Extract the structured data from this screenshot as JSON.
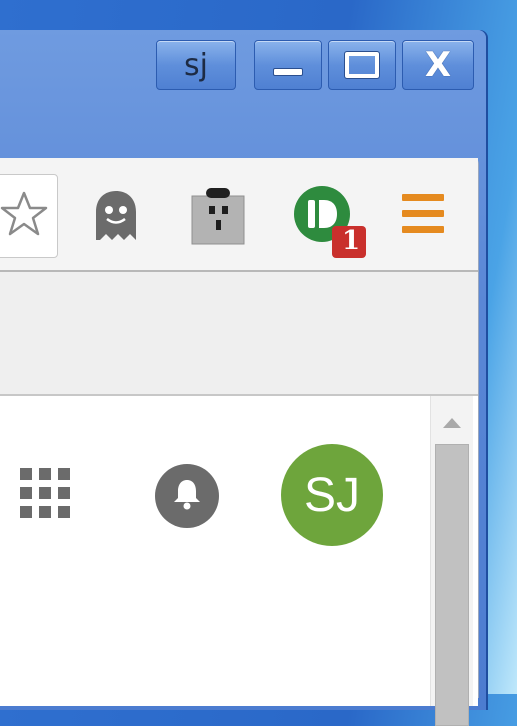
{
  "window": {
    "profile_label": "sj",
    "controls": {
      "minimize_icon": "minimize-icon",
      "maximize_icon": "maximize-icon",
      "close_label": "X"
    }
  },
  "toolbar": {
    "bookmark_icon": "star-icon",
    "extensions": [
      {
        "name": "ghostery",
        "icon": "ghost-icon"
      },
      {
        "name": "face",
        "icon": "square-face-icon"
      },
      {
        "name": "pushbullet",
        "icon": "pushbullet-icon",
        "badge": "1"
      },
      {
        "name": "menu",
        "icon": "hamburger-menu-icon"
      }
    ]
  },
  "page": {
    "apps_icon": "apps-grid-icon",
    "notifications_icon": "bell-icon",
    "avatar_initials": "SJ"
  },
  "colors": {
    "title_bar": "#5a87d6",
    "avatar": "#6ea53c",
    "pushbullet_green": "#2e8b3e",
    "badge_red": "#c9302c",
    "menu_orange": "#e58a1f"
  }
}
